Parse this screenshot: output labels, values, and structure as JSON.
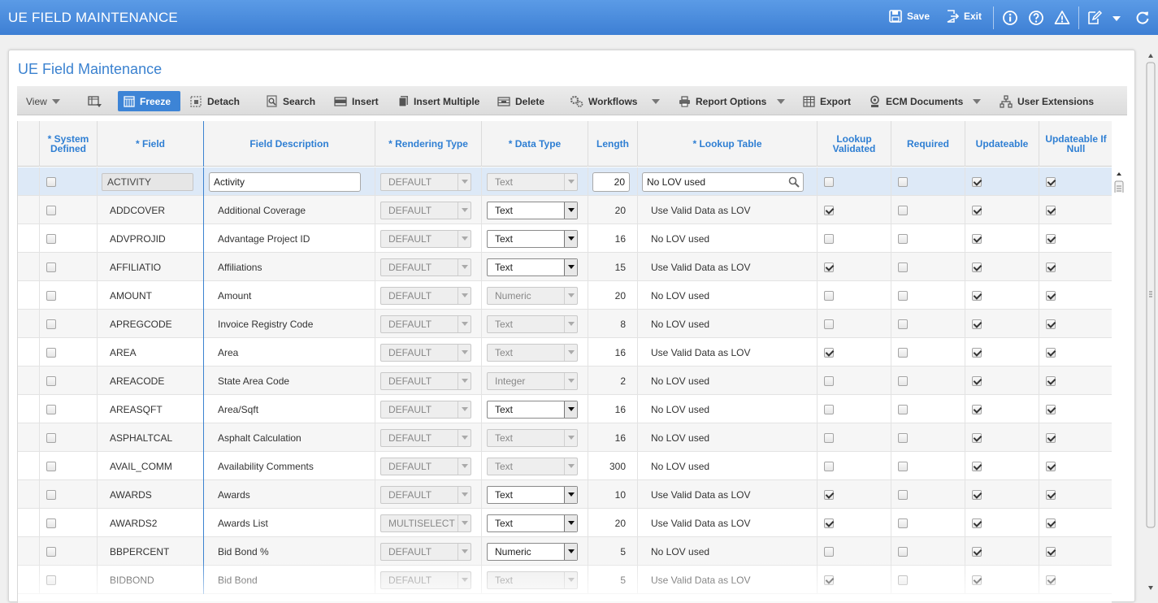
{
  "app": {
    "title": "UE FIELD MAINTENANCE",
    "save_label": "Save",
    "exit_label": "Exit",
    "icons": [
      "save-icon",
      "exit-icon",
      "info-icon",
      "help-icon",
      "warning-icon",
      "edit-icon",
      "chevron-down-icon",
      "refresh-icon"
    ],
    "accent": "#3d84d6"
  },
  "panel": {
    "title": "UE Field Maintenance"
  },
  "toolbar": {
    "view": "View",
    "freeze": "Freeze",
    "detach": "Detach",
    "search": "Search",
    "insert": "Insert",
    "insert_multiple": "Insert Multiple",
    "delete": "Delete",
    "workflows": "Workflows",
    "report_options": "Report Options",
    "export": "Export",
    "ecm_documents": "ECM Documents",
    "user_extensions": "User Extensions"
  },
  "grid": {
    "columns": {
      "system_defined": [
        "* System",
        "Defined"
      ],
      "field": "* Field",
      "description": "Field Description",
      "rendering": "* Rendering Type",
      "data_type": "* Data Type",
      "length": "Length",
      "lookup_table": "* Lookup Table",
      "lookup_validated": [
        "Lookup",
        "Validated"
      ],
      "required": "Required",
      "updateable": "Updateable",
      "updateable_null": [
        "Updateable If",
        "Null"
      ]
    },
    "rows": [
      {
        "sys": false,
        "field": "ACTIVITY",
        "desc": "Activity",
        "render": "DEFAULT",
        "dtype": "Text",
        "dtype_enabled": false,
        "length": "20",
        "lookup": "No LOV used",
        "lv": false,
        "req": false,
        "upd": true,
        "upn": true
      },
      {
        "sys": false,
        "field": "ADDCOVER",
        "desc": "Additional Coverage",
        "render": "DEFAULT",
        "dtype": "Text",
        "dtype_enabled": true,
        "length": "20",
        "lookup": "Use Valid Data as LOV",
        "lv": true,
        "req": false,
        "upd": true,
        "upn": true
      },
      {
        "sys": false,
        "field": "ADVPROJID",
        "desc": "Advantage Project ID",
        "render": "DEFAULT",
        "dtype": "Text",
        "dtype_enabled": true,
        "length": "16",
        "lookup": "No LOV used",
        "lv": false,
        "req": false,
        "upd": true,
        "upn": true
      },
      {
        "sys": false,
        "field": "AFFILIATIO",
        "desc": "Affiliations",
        "render": "DEFAULT",
        "dtype": "Text",
        "dtype_enabled": true,
        "length": "15",
        "lookup": "Use Valid Data as LOV",
        "lv": true,
        "req": false,
        "upd": true,
        "upn": true
      },
      {
        "sys": false,
        "field": "AMOUNT",
        "desc": "Amount",
        "render": "DEFAULT",
        "dtype": "Numeric",
        "dtype_enabled": false,
        "length": "20",
        "lookup": "No LOV used",
        "lv": false,
        "req": false,
        "upd": true,
        "upn": true
      },
      {
        "sys": false,
        "field": "APREGCODE",
        "desc": "Invoice Registry Code",
        "render": "DEFAULT",
        "dtype": "Text",
        "dtype_enabled": false,
        "length": "8",
        "lookup": "No LOV used",
        "lv": false,
        "req": false,
        "upd": true,
        "upn": true
      },
      {
        "sys": false,
        "field": "AREA",
        "desc": "Area",
        "render": "DEFAULT",
        "dtype": "Text",
        "dtype_enabled": false,
        "length": "16",
        "lookup": "Use Valid Data as LOV",
        "lv": true,
        "req": false,
        "upd": true,
        "upn": true
      },
      {
        "sys": false,
        "field": "AREACODE",
        "desc": "State Area Code",
        "render": "DEFAULT",
        "dtype": "Integer",
        "dtype_enabled": false,
        "length": "2",
        "lookup": "No LOV used",
        "lv": false,
        "req": false,
        "upd": true,
        "upn": true
      },
      {
        "sys": false,
        "field": "AREASQFT",
        "desc": "Area/Sqft",
        "render": "DEFAULT",
        "dtype": "Text",
        "dtype_enabled": true,
        "length": "16",
        "lookup": "No LOV used",
        "lv": false,
        "req": false,
        "upd": true,
        "upn": true
      },
      {
        "sys": false,
        "field": "ASPHALTCAL",
        "desc": "Asphalt Calculation",
        "render": "DEFAULT",
        "dtype": "Text",
        "dtype_enabled": false,
        "length": "16",
        "lookup": "No LOV used",
        "lv": false,
        "req": false,
        "upd": true,
        "upn": true
      },
      {
        "sys": false,
        "field": "AVAIL_COMM",
        "desc": "Availability Comments",
        "render": "DEFAULT",
        "dtype": "Text",
        "dtype_enabled": false,
        "length": "300",
        "lookup": "No LOV used",
        "lv": false,
        "req": false,
        "upd": true,
        "upn": true
      },
      {
        "sys": false,
        "field": "AWARDS",
        "desc": "Awards",
        "render": "DEFAULT",
        "dtype": "Text",
        "dtype_enabled": true,
        "length": "10",
        "lookup": "Use Valid Data as LOV",
        "lv": true,
        "req": false,
        "upd": true,
        "upn": true
      },
      {
        "sys": false,
        "field": "AWARDS2",
        "desc": "Awards List",
        "render": "MULTISELECT",
        "dtype": "Text",
        "dtype_enabled": true,
        "length": "20",
        "lookup": "Use Valid Data as LOV",
        "lv": true,
        "req": false,
        "upd": true,
        "upn": true
      },
      {
        "sys": false,
        "field": "BBPERCENT",
        "desc": "Bid Bond %",
        "render": "DEFAULT",
        "dtype": "Numeric",
        "dtype_enabled": true,
        "length": "5",
        "lookup": "No LOV used",
        "lv": false,
        "req": false,
        "upd": true,
        "upn": true
      },
      {
        "sys": false,
        "field": "BIDBOND",
        "desc": "Bid Bond",
        "render": "DEFAULT",
        "dtype": "Text",
        "dtype_enabled": false,
        "length": "5",
        "lookup": "Use Valid Data as LOV",
        "lv": true,
        "req": false,
        "upd": true,
        "upn": true
      }
    ]
  }
}
